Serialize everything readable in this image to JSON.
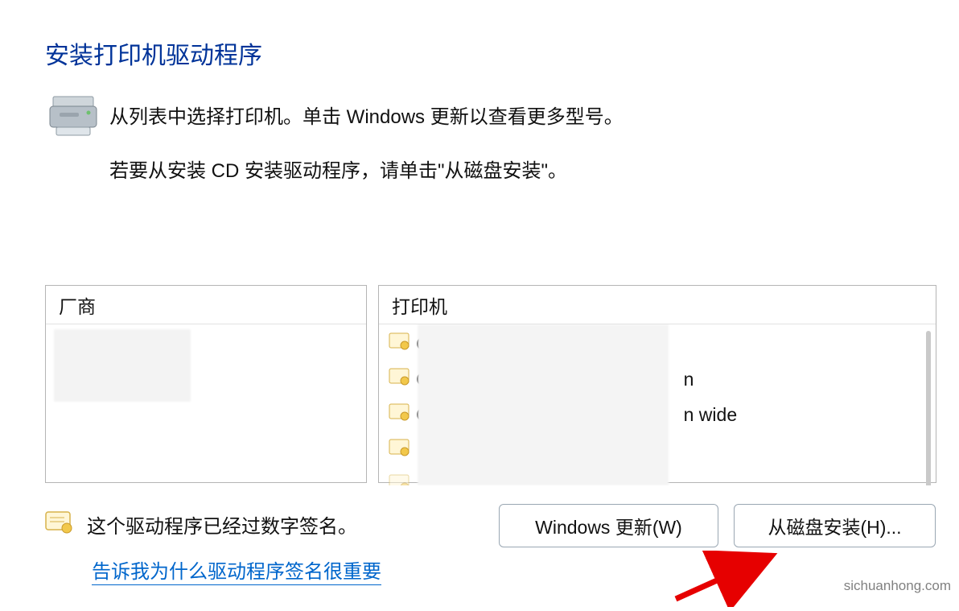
{
  "heading": "安装打印机驱动程序",
  "intro": {
    "line1": "从列表中选择打印机。单击 Windows 更新以查看更多型号。",
    "line2": "若要从安装 CD 安装驱动程序，请单击\"从磁盘安装\"。"
  },
  "panels": {
    "manufacturer_header": "厂商",
    "printer_header": "打印机",
    "printer_rows": [
      {
        "prefix": "C",
        "suffix": ""
      },
      {
        "prefix": "C",
        "suffix": "n"
      },
      {
        "prefix": "C",
        "suffix": "n wide"
      },
      {
        "prefix": "",
        "suffix": ""
      },
      {
        "prefix": "",
        "suffix": ""
      }
    ]
  },
  "signature": {
    "text": "这个驱动程序已经过数字签名。",
    "link": "告诉我为什么驱动程序签名很重要"
  },
  "buttons": {
    "windows_update": "Windows 更新(W)",
    "install_from_disk": "从磁盘安装(H)..."
  },
  "watermark": "sichuanhong.com"
}
